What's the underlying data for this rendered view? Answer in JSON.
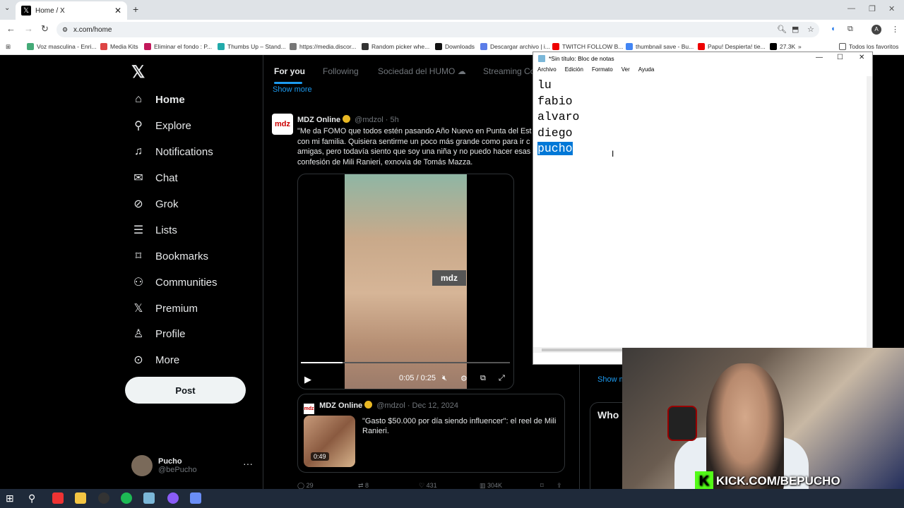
{
  "browser": {
    "tab_title": "Home / X",
    "url": "x.com/home",
    "bookmarks": [
      "Voz masculina - Enri...",
      "Media Kits",
      "Eliminar el fondo : P...",
      "Thumbs Up – Stand...",
      "https://media.discor...",
      "Random picker whe...",
      "Downloads",
      "Descargar archivo | i...",
      "TWITCH FOLLOW B...",
      "thumbnail save - Bu...",
      "Papu! Despierta! tie...",
      "27.3K",
      "Todos los favoritos"
    ]
  },
  "sidebar": {
    "items": [
      {
        "label": "Home",
        "icon": "home-icon"
      },
      {
        "label": "Explore",
        "icon": "search-icon"
      },
      {
        "label": "Notifications",
        "icon": "bell-icon"
      },
      {
        "label": "Chat",
        "icon": "mail-icon"
      },
      {
        "label": "Grok",
        "icon": "grok-icon"
      },
      {
        "label": "Lists",
        "icon": "list-icon"
      },
      {
        "label": "Bookmarks",
        "icon": "bookmark-icon"
      },
      {
        "label": "Communities",
        "icon": "people-icon"
      },
      {
        "label": "Premium",
        "icon": "x-icon"
      },
      {
        "label": "Profile",
        "icon": "person-icon"
      },
      {
        "label": "More",
        "icon": "more-icon"
      }
    ],
    "post_label": "Post",
    "profile_name": "Pucho",
    "profile_handle": "@bePucho"
  },
  "feed": {
    "tabs": [
      "For you",
      "Following",
      "Sociedad del HUMO ☁",
      "Streaming Co"
    ],
    "show_more": "Show more",
    "tweet": {
      "author": "MDZ Online",
      "handle": "@mdzol",
      "time": "· 5h",
      "avatar_text": "mdz",
      "lines": [
        "\"Me da FOMO que todos estén pasando Año Nuevo en Punta del Est",
        "con mi familia. Quisiera sentirme un poco más grande como para ir c",
        "amigas, pero todavía siento que soy una niña y no puedo hacer esas",
        "confesión de Mili Ranieri, exnovia de Tomás Mazza."
      ],
      "video_watermark": "mdz",
      "video_time": "0:05 / 0:25",
      "video_progress": 0.2,
      "quote": {
        "author": "MDZ Online",
        "handle": "@mdzol",
        "date": "· Dec 12, 2024",
        "text": "\"Gasto $50.000 por día siendo influencer\": el reel de Mili Ranieri.",
        "duration": "0:49"
      },
      "replies": "29",
      "reposts": "8",
      "likes": "431",
      "views": "304K"
    }
  },
  "right": {
    "show_more": "Show m",
    "who_to_follow": "Who"
  },
  "notepad": {
    "title": "*Sin título: Bloc de notas",
    "menu": [
      "Archivo",
      "Edición",
      "Formato",
      "Ver",
      "Ayuda"
    ],
    "lines": [
      "lu",
      "fabio",
      "alvaro",
      "diego",
      "pucho"
    ]
  },
  "overlay": {
    "kick_text": "KICK.COM/BEPUCHO"
  }
}
